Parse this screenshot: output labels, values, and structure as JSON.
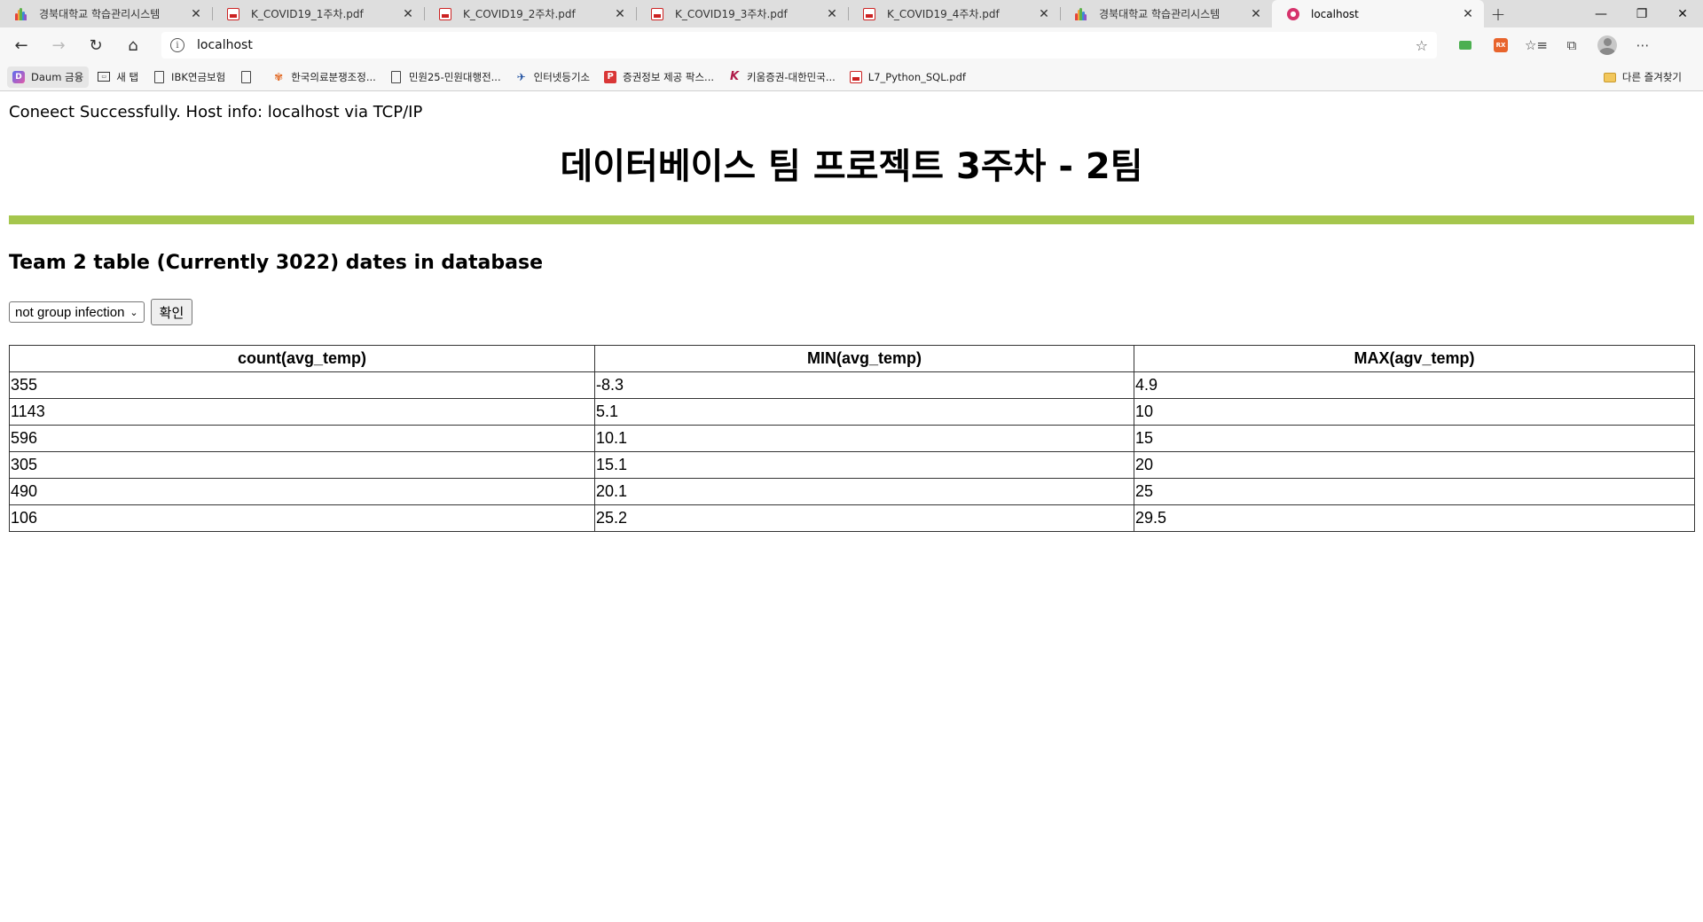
{
  "browser": {
    "tabs": [
      {
        "title": "경북대학교 학습관리시스템",
        "icon": "knu-icon",
        "active": false
      },
      {
        "title": "K_COVID19_1주차.pdf",
        "icon": "pdf-icon",
        "active": false
      },
      {
        "title": "K_COVID19_2주차.pdf",
        "icon": "pdf-icon",
        "active": false
      },
      {
        "title": "K_COVID19_3주차.pdf",
        "icon": "pdf-icon",
        "active": false
      },
      {
        "title": "K_COVID19_4주차.pdf",
        "icon": "pdf-icon",
        "active": false
      },
      {
        "title": "경북대학교 학습관리시스템",
        "icon": "knu-icon",
        "active": false
      },
      {
        "title": "localhost",
        "icon": "localhost-icon",
        "active": true
      }
    ],
    "close_glyph": "✕",
    "new_tab_glyph": "+",
    "window": {
      "minimize": "—",
      "maximize": "❐",
      "close": "✕"
    },
    "address": {
      "url": "localhost"
    },
    "nav": {
      "back": "←",
      "forward": "→",
      "reload": "↻",
      "home": "⌂"
    },
    "ext_orange_label": "RX",
    "bookmarks": [
      {
        "label": "Daum 금융",
        "icon": "daum-icon"
      },
      {
        "label": "새 탭",
        "icon": "new-tab-icon"
      },
      {
        "label": "IBK연금보험",
        "icon": "page-icon"
      },
      {
        "label": "",
        "icon": "page-icon"
      },
      {
        "label": "한국의료분쟁조정...",
        "icon": "flower-icon"
      },
      {
        "label": "민원25-민원대행전...",
        "icon": "page-icon"
      },
      {
        "label": "인터넷등기소",
        "icon": "registry-icon"
      },
      {
        "label": "증권정보 제공 팍스...",
        "icon": "paxnet-icon"
      },
      {
        "label": "키움증권-대한민국...",
        "icon": "kiwoom-icon"
      },
      {
        "label": "L7_Python_SQL.pdf",
        "icon": "pdf-icon"
      }
    ],
    "other_favorites": "다른 즐겨찾기"
  },
  "page": {
    "status": "Coneect Successfully. Host info: localhost via TCP/IP",
    "title": "데이터베이스 팀 프로젝트 3주차 - 2팀",
    "section_title": "Team 2 table (Currently 3022) dates in database",
    "accent_color": "#a5c64d",
    "form": {
      "select_value": "not group infection",
      "submit_label": "확인"
    },
    "table": {
      "headers": [
        "count(avg_temp)",
        "MIN(avg_temp)",
        "MAX(agv_temp)"
      ],
      "rows": [
        [
          "355",
          "-8.3",
          "4.9"
        ],
        [
          "1143",
          "5.1",
          "10"
        ],
        [
          "596",
          "10.1",
          "15"
        ],
        [
          "305",
          "15.1",
          "20"
        ],
        [
          "490",
          "20.1",
          "25"
        ],
        [
          "106",
          "25.2",
          "29.5"
        ]
      ]
    }
  }
}
